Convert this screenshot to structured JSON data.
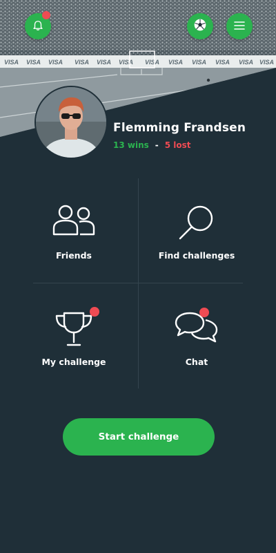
{
  "colors": {
    "accent": "#2bb34f",
    "alert": "#ef4b53",
    "background": "#1f2f38"
  },
  "header": {
    "left_icon": "bell-icon",
    "right_icons": [
      "soccer-ball-icon",
      "hamburger-menu-icon"
    ]
  },
  "profile": {
    "name": "Flemming Frandsen",
    "wins": "13 wins",
    "separator": "-",
    "lost": "5 lost"
  },
  "tiles": [
    {
      "label": "Friends",
      "icon": "friends-icon",
      "notification": false
    },
    {
      "label": "Find challenges",
      "icon": "search-icon",
      "notification": false
    },
    {
      "label": "My challenge",
      "icon": "trophy-icon",
      "notification": true
    },
    {
      "label": "Chat",
      "icon": "chat-icon",
      "notification": true
    }
  ],
  "actions": {
    "start_label": "Start challenge"
  }
}
